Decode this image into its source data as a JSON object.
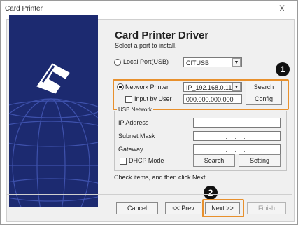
{
  "window": {
    "title": "Card Printer",
    "close_symbol": "X"
  },
  "header": {
    "title": "Card Printer Driver",
    "subtitle": "Select a port to install."
  },
  "local_port": {
    "label": "Local Port(USB)",
    "selected": false,
    "value": "CITUSB"
  },
  "network_printer": {
    "label": "Network Printer",
    "selected": true,
    "value": "IP_192.168.0.11..",
    "search_label": "Search"
  },
  "input_by_user": {
    "label": "Input by User",
    "checked": false,
    "value": "000.000.000.000",
    "config_label": "Config"
  },
  "usb_network": {
    "group_title": "USB Network",
    "ip_label": "IP Address",
    "subnet_label": "Subnet Mask",
    "gateway_label": "Gateway",
    "dhcp_label": "DHCP Mode",
    "ip_value": ". . .",
    "subnet_value": ". . .",
    "gateway_value": ". . .",
    "search_label": "Search",
    "setting_label": "Setting"
  },
  "instruction": "Check items, and then click Next.",
  "footer": {
    "cancel_label": "Cancel",
    "back_label": "<< Prev",
    "next_label": "Next >>",
    "finish_label": "Finish"
  },
  "badges": {
    "one": "1",
    "two": "2"
  },
  "colors": {
    "highlight": "#e8902c",
    "left_panel": "#1c2a70"
  },
  "icons": {
    "printer_card": "printer-card-icon",
    "globe": "globe-graphic"
  }
}
